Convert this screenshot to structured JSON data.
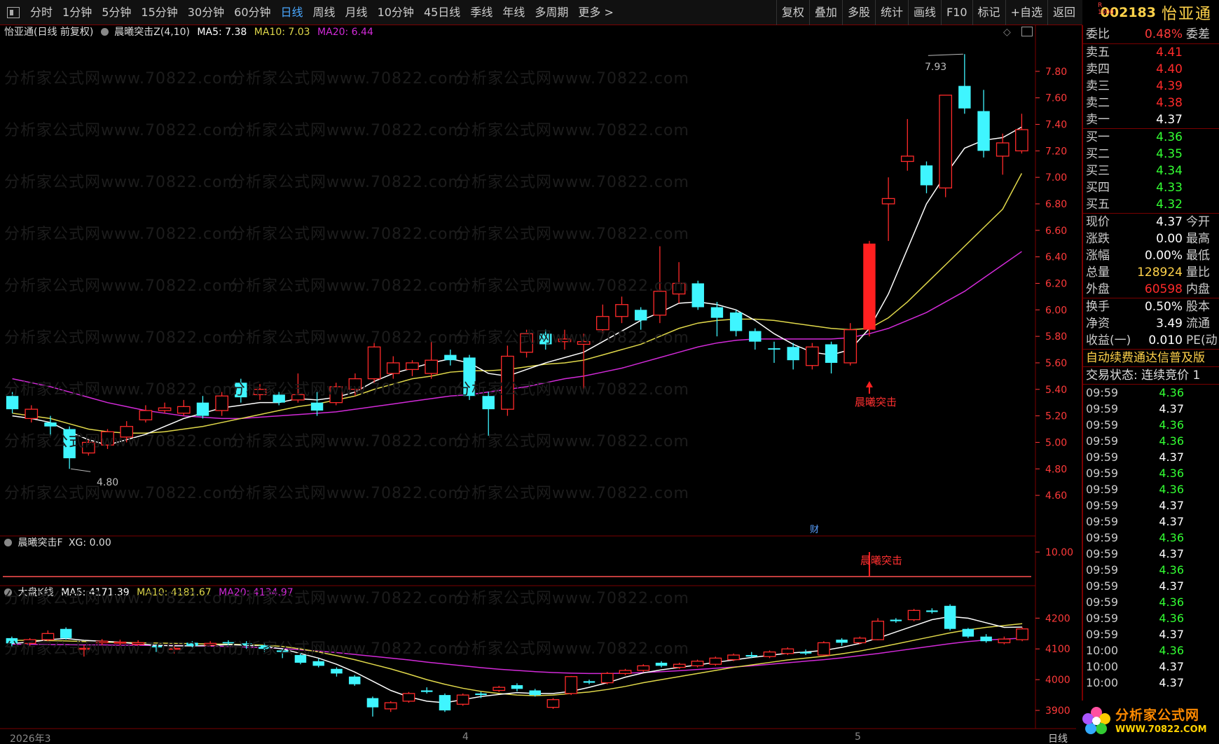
{
  "toolbar": {
    "periods": [
      "分时",
      "1分钟",
      "5分钟",
      "15分钟",
      "30分钟",
      "60分钟",
      "日线",
      "周线",
      "月线",
      "10分钟",
      "45日线",
      "季线",
      "年线",
      "多周期",
      "更多 >"
    ],
    "active_period": "日线",
    "actions": [
      "复权",
      "叠加",
      "多股",
      "统计",
      "画线",
      "F10",
      "标记",
      "+自选",
      "返回"
    ]
  },
  "stock": {
    "code": "002183",
    "name": "怡亚通",
    "tag_top": "R",
    "tag_bottom": "1000"
  },
  "main_panel": {
    "title": "怡亚通(日线 前复权)",
    "indicator": "晨曦突击Z(4,10)",
    "ma5": "MA5: 7.38",
    "ma10": "MA10: 7.03",
    "ma20": "MA20: 6.44",
    "high_label": "7.93",
    "low_label": "4.80",
    "signal_label": "晨曦突击",
    "cai_label": "财"
  },
  "sub1": {
    "title": "晨曦突击F",
    "xg": "XG: 0.00",
    "signal_label": "晨曦突击"
  },
  "sub2": {
    "title": "大盘K线",
    "ma5": "MA5: 4171.39",
    "ma10": "MA10: 4181.67",
    "ma20": "MA20: 4134.97"
  },
  "date_axis": {
    "start": "2026年3",
    "april": "4",
    "may": "5",
    "period_label": "日线"
  },
  "watermark": "分析家公式网www.70822.com",
  "colors": {
    "up": "#ff2a2a",
    "down": "#3ff5ff",
    "ma5": "#ffffff",
    "ma10": "#e0d84a",
    "ma20": "#d22ad8",
    "axis": "#ff3a3a",
    "green": "#33ff33",
    "yellow": "#ffd24a"
  },
  "quote": {
    "wb_label": "委比",
    "wb_value": "0.48%",
    "wb_tail": "委差",
    "asks": [
      {
        "label": "卖五",
        "price": "4.41"
      },
      {
        "label": "卖四",
        "price": "4.40"
      },
      {
        "label": "卖三",
        "price": "4.39"
      },
      {
        "label": "卖二",
        "price": "4.38"
      },
      {
        "label": "卖一",
        "price": "4.37"
      }
    ],
    "bids": [
      {
        "label": "买一",
        "price": "4.36"
      },
      {
        "label": "买二",
        "price": "4.35"
      },
      {
        "label": "买三",
        "price": "4.34"
      },
      {
        "label": "买四",
        "price": "4.33"
      },
      {
        "label": "买五",
        "price": "4.32"
      }
    ],
    "stats": [
      {
        "label": "现价",
        "value": "4.37",
        "tail": "今开"
      },
      {
        "label": "涨跌",
        "value": "0.00",
        "tail": "最高"
      },
      {
        "label": "涨幅",
        "value": "0.00%",
        "tail": "最低"
      },
      {
        "label": "总量",
        "value": "128924",
        "tail": "量比"
      },
      {
        "label": "外盘",
        "value": "60598",
        "tail": "内盘"
      }
    ],
    "stats2": [
      {
        "label": "换手",
        "value": "0.50%",
        "tail": "股本"
      },
      {
        "label": "净资",
        "value": "3.49",
        "tail": "流通"
      },
      {
        "label": "收益(一)",
        "value": "0.010",
        "tail": "PE(动"
      }
    ],
    "marquee": "自动续费通达信普及版",
    "trade_status": "交易状态: 连续竞价 1"
  },
  "ticks": [
    {
      "t": "09:59",
      "p": "4.36"
    },
    {
      "t": "09:59",
      "p": "4.37"
    },
    {
      "t": "09:59",
      "p": "4.36"
    },
    {
      "t": "09:59",
      "p": "4.36"
    },
    {
      "t": "09:59",
      "p": "4.37"
    },
    {
      "t": "09:59",
      "p": "4.36"
    },
    {
      "t": "09:59",
      "p": "4.36"
    },
    {
      "t": "09:59",
      "p": "4.37"
    },
    {
      "t": "09:59",
      "p": "4.37"
    },
    {
      "t": "09:59",
      "p": "4.36"
    },
    {
      "t": "09:59",
      "p": "4.37"
    },
    {
      "t": "09:59",
      "p": "4.36"
    },
    {
      "t": "09:59",
      "p": "4.37"
    },
    {
      "t": "09:59",
      "p": "4.36"
    },
    {
      "t": "09:59",
      "p": "4.36"
    },
    {
      "t": "09:59",
      "p": "4.37"
    },
    {
      "t": "10:00",
      "p": "4.36"
    },
    {
      "t": "10:00",
      "p": "4.37"
    },
    {
      "t": "10:00",
      "p": "4.37"
    }
  ],
  "logo": {
    "line1": "分析家公式网",
    "line2": "WWW.70822.COM"
  },
  "chart_data": [
    {
      "type": "candlestick",
      "title": "怡亚通(日线 前复权)",
      "ylim": [
        4.5,
        8.0
      ],
      "yticks": [
        "7.80",
        "7.60",
        "7.40",
        "7.20",
        "7.00",
        "6.80",
        "6.60",
        "6.40",
        "6.20",
        "6.00",
        "5.80",
        "5.60",
        "5.40",
        "5.20",
        "5.00",
        "4.80",
        "4.60"
      ],
      "candles": [
        [
          5.35,
          5.25,
          5.38,
          5.22
        ],
        [
          5.18,
          5.25,
          5.28,
          5.15
        ],
        [
          5.15,
          5.12,
          5.2,
          5.05
        ],
        [
          5.1,
          4.88,
          5.12,
          4.8
        ],
        [
          4.92,
          5.0,
          5.02,
          4.9
        ],
        [
          4.98,
          5.08,
          5.1,
          4.95
        ],
        [
          5.04,
          5.12,
          5.16,
          5.0
        ],
        [
          5.17,
          5.24,
          5.28,
          5.15
        ],
        [
          5.24,
          5.26,
          5.3,
          5.22
        ],
        [
          5.22,
          5.27,
          5.32,
          5.2
        ],
        [
          5.3,
          5.2,
          5.35,
          5.18
        ],
        [
          5.24,
          5.35,
          5.38,
          5.2
        ],
        [
          5.45,
          5.34,
          5.48,
          5.3
        ],
        [
          5.36,
          5.4,
          5.44,
          5.32
        ],
        [
          5.36,
          5.3,
          5.38,
          5.28
        ],
        [
          5.32,
          5.36,
          5.52,
          5.3
        ],
        [
          5.3,
          5.24,
          5.38,
          5.2
        ],
        [
          5.3,
          5.42,
          5.45,
          5.28
        ],
        [
          5.4,
          5.48,
          5.52,
          5.35
        ],
        [
          5.48,
          5.72,
          5.75,
          5.45
        ],
        [
          5.52,
          5.6,
          5.65,
          5.48
        ],
        [
          5.55,
          5.6,
          5.62,
          5.5
        ],
        [
          5.52,
          5.62,
          5.76,
          5.48
        ],
        [
          5.66,
          5.62,
          5.7,
          5.58
        ],
        [
          5.64,
          5.35,
          5.66,
          5.32
        ],
        [
          5.35,
          5.25,
          5.38,
          5.05
        ],
        [
          5.25,
          5.65,
          5.73,
          5.2
        ],
        [
          5.68,
          5.82,
          5.85,
          5.64
        ],
        [
          5.82,
          5.74,
          5.85,
          5.7
        ],
        [
          5.76,
          5.78,
          5.85,
          5.7
        ],
        [
          5.74,
          5.76,
          5.82,
          5.4
        ],
        [
          5.85,
          5.95,
          6.04,
          5.82
        ],
        [
          5.95,
          6.04,
          6.1,
          5.9
        ],
        [
          6.0,
          5.92,
          6.02,
          5.85
        ],
        [
          5.96,
          6.14,
          6.48,
          5.9
        ],
        [
          6.12,
          6.2,
          6.36,
          6.05
        ],
        [
          6.2,
          6.02,
          6.22,
          6.0
        ],
        [
          6.02,
          5.94,
          6.06,
          5.8
        ],
        [
          5.98,
          5.84,
          6.0,
          5.8
        ],
        [
          5.84,
          5.76,
          5.86,
          5.7
        ],
        [
          5.71,
          5.7,
          5.76,
          5.6
        ],
        [
          5.72,
          5.62,
          5.75,
          5.55
        ],
        [
          5.58,
          5.72,
          5.75,
          5.55
        ],
        [
          5.74,
          5.6,
          5.76,
          5.52
        ],
        [
          5.6,
          5.85,
          5.9,
          5.58
        ],
        [
          5.85,
          6.5,
          6.52,
          5.8
        ],
        [
          6.8,
          6.84,
          7.0,
          6.52
        ],
        [
          7.12,
          7.16,
          7.44,
          7.05
        ],
        [
          7.09,
          6.94,
          7.12,
          6.88
        ],
        [
          6.92,
          7.62,
          7.62,
          6.85
        ],
        [
          7.69,
          7.52,
          7.93,
          7.48
        ],
        [
          7.5,
          7.2,
          7.66,
          7.15
        ],
        [
          7.16,
          7.26,
          7.33,
          7.02
        ],
        [
          7.2,
          7.36,
          7.48,
          7.18
        ]
      ],
      "ma5": [
        5.2,
        5.18,
        5.15,
        5.08,
        5.02,
        4.98,
        5.02,
        5.06,
        5.12,
        5.18,
        5.22,
        5.26,
        5.28,
        5.3,
        5.3,
        5.33,
        5.32,
        5.34,
        5.38,
        5.46,
        5.52,
        5.56,
        5.6,
        5.63,
        5.6,
        5.52,
        5.5,
        5.55,
        5.6,
        5.64,
        5.68,
        5.76,
        5.84,
        5.92,
        5.98,
        6.05,
        6.06,
        6.04,
        6.0,
        5.92,
        5.82,
        5.74,
        5.68,
        5.66,
        5.7,
        5.86,
        6.12,
        6.46,
        6.8,
        7.02,
        7.22,
        7.28,
        7.3,
        7.38
      ],
      "ma10": [
        5.22,
        5.2,
        5.18,
        5.14,
        5.1,
        5.08,
        5.07,
        5.07,
        5.08,
        5.1,
        5.12,
        5.15,
        5.18,
        5.21,
        5.24,
        5.27,
        5.29,
        5.32,
        5.35,
        5.4,
        5.44,
        5.48,
        5.5,
        5.53,
        5.54,
        5.54,
        5.55,
        5.57,
        5.59,
        5.6,
        5.62,
        5.66,
        5.7,
        5.74,
        5.8,
        5.86,
        5.9,
        5.92,
        5.93,
        5.93,
        5.92,
        5.9,
        5.88,
        5.86,
        5.85,
        5.86,
        5.94,
        6.06,
        6.2,
        6.34,
        6.48,
        6.62,
        6.76,
        7.03
      ],
      "ma20": [
        5.48,
        5.45,
        5.42,
        5.38,
        5.34,
        5.3,
        5.27,
        5.24,
        5.22,
        5.2,
        5.19,
        5.18,
        5.18,
        5.19,
        5.2,
        5.21,
        5.22,
        5.23,
        5.25,
        5.27,
        5.29,
        5.31,
        5.33,
        5.35,
        5.36,
        5.38,
        5.4,
        5.42,
        5.45,
        5.48,
        5.5,
        5.53,
        5.56,
        5.6,
        5.64,
        5.68,
        5.72,
        5.75,
        5.77,
        5.78,
        5.78,
        5.78,
        5.78,
        5.78,
        5.79,
        5.82,
        5.86,
        5.92,
        5.98,
        6.06,
        6.14,
        6.24,
        6.34,
        6.44
      ]
    },
    {
      "type": "line",
      "title": "晨曦突击F",
      "ylim": [
        0,
        10
      ],
      "yticks": [
        "10.00"
      ],
      "signal_index": 45,
      "signal_value": 10
    },
    {
      "type": "candlestick",
      "title": "大盘K线",
      "ylim": [
        3850,
        4260
      ],
      "yticks": [
        "4200",
        "4100",
        "4000",
        "3900"
      ],
      "candles": [
        [
          4135,
          4118,
          4140,
          4105
        ],
        [
          4118,
          4130,
          4135,
          4110
        ],
        [
          4130,
          4150,
          4160,
          4125
        ],
        [
          4165,
          4135,
          4170,
          4130
        ],
        [
          4100,
          4102,
          4112,
          4075
        ],
        [
          4120,
          4125,
          4132,
          4110
        ],
        [
          4120,
          4122,
          4130,
          4112
        ],
        [
          4115,
          4120,
          4128,
          4108
        ],
        [
          4110,
          4105,
          4115,
          4090
        ],
        [
          4100,
          4102,
          4108,
          4085
        ],
        [
          4120,
          4110,
          4125,
          4105
        ],
        [
          4112,
          4118,
          4125,
          4108
        ],
        [
          4122,
          4118,
          4128,
          4112
        ],
        [
          4118,
          4112,
          4125,
          4100
        ],
        [
          4112,
          4100,
          4118,
          4090
        ],
        [
          4095,
          4090,
          4100,
          4070
        ],
        [
          4080,
          4055,
          4085,
          4050
        ],
        [
          4060,
          4045,
          4068,
          4040
        ],
        [
          4035,
          4020,
          4040,
          4010
        ],
        [
          4010,
          3985,
          4015,
          3980
        ],
        [
          3940,
          3910,
          3945,
          3880
        ],
        [
          3905,
          3925,
          3930,
          3895
        ],
        [
          3930,
          3955,
          3960,
          3925
        ],
        [
          3965,
          3960,
          3975,
          3955
        ],
        [
          3950,
          3900,
          3955,
          3895
        ],
        [
          3920,
          3950,
          3955,
          3915
        ],
        [
          3955,
          3950,
          3960,
          3940
        ],
        [
          3965,
          3975,
          3980,
          3960
        ],
        [
          3982,
          3970,
          3988,
          3962
        ],
        [
          3965,
          3950,
          3970,
          3945
        ],
        [
          3910,
          3935,
          3940,
          3905
        ],
        [
          3955,
          4010,
          4012,
          3950
        ],
        [
          3995,
          3990,
          4000,
          3985
        ],
        [
          3990,
          4020,
          4025,
          3985
        ],
        [
          4020,
          4030,
          4035,
          4015
        ],
        [
          4030,
          4045,
          4050,
          4025
        ],
        [
          4055,
          4045,
          4060,
          4040
        ],
        [
          4040,
          4050,
          4055,
          4035
        ],
        [
          4045,
          4060,
          4065,
          4040
        ],
        [
          4050,
          4070,
          4075,
          4045
        ],
        [
          4065,
          4080,
          4085,
          4060
        ],
        [
          4080,
          4075,
          4090,
          4070
        ],
        [
          4075,
          4090,
          4095,
          4070
        ],
        [
          4085,
          4100,
          4105,
          4080
        ],
        [
          4090,
          4085,
          4098,
          4080
        ],
        [
          4080,
          4120,
          4125,
          4078
        ],
        [
          4130,
          4120,
          4135,
          4110
        ],
        [
          4120,
          4135,
          4140,
          4115
        ],
        [
          4130,
          4190,
          4200,
          4128
        ],
        [
          4195,
          4190,
          4200,
          4185
        ],
        [
          4195,
          4225,
          4230,
          4190
        ],
        [
          4225,
          4220,
          4232,
          4215
        ],
        [
          4240,
          4165,
          4245,
          4160
        ],
        [
          4165,
          4140,
          4168,
          4135
        ],
        [
          4140,
          4125,
          4148,
          4120
        ],
        [
          4120,
          4132,
          4140,
          4115
        ],
        [
          4130,
          4165,
          4170,
          4125
        ]
      ],
      "ma5": [
        4118,
        4122,
        4130,
        4134,
        4128,
        4125,
        4122,
        4116,
        4112,
        4110,
        4110,
        4111,
        4114,
        4112,
        4108,
        4100,
        4085,
        4070,
        4050,
        4025,
        3995,
        3965,
        3944,
        3930,
        3925,
        3935,
        3945,
        3952,
        3958,
        3955,
        3955,
        3962,
        3975,
        3990,
        4008,
        4022,
        4032,
        4040,
        4048,
        4056,
        4064,
        4072,
        4079,
        4086,
        4090,
        4095,
        4105,
        4118,
        4135,
        4155,
        4175,
        4195,
        4205,
        4200,
        4185,
        4170,
        4171
      ],
      "ma10": [
        4128,
        4128,
        4127,
        4126,
        4124,
        4122,
        4121,
        4120,
        4119,
        4118,
        4117,
        4116,
        4115,
        4114,
        4112,
        4108,
        4100,
        4090,
        4078,
        4065,
        4050,
        4035,
        4018,
        4000,
        3985,
        3972,
        3962,
        3955,
        3950,
        3948,
        3950,
        3955,
        3960,
        3968,
        3978,
        3990,
        4000,
        4010,
        4020,
        4030,
        4040,
        4048,
        4056,
        4064,
        4070,
        4076,
        4084,
        4093,
        4104,
        4116,
        4128,
        4140,
        4152,
        4162,
        4170,
        4176,
        4182
      ],
      "ma20": [
        4115,
        4115,
        4114,
        4114,
        4113,
        4113,
        4112,
        4112,
        4111,
        4111,
        4110,
        4109,
        4108,
        4106,
        4104,
        4101,
        4097,
        4093,
        4088,
        4082,
        4076,
        4070,
        4064,
        4057,
        4051,
        4045,
        4039,
        4034,
        4030,
        4026,
        4023,
        4021,
        4020,
        4020,
        4021,
        4023,
        4026,
        4029,
        4033,
        4037,
        4041,
        4045,
        4050,
        4055,
        4060,
        4065,
        4071,
        4078,
        4085,
        4093,
        4101,
        4109,
        4117,
        4124,
        4129,
        4132,
        4135
      ]
    }
  ]
}
